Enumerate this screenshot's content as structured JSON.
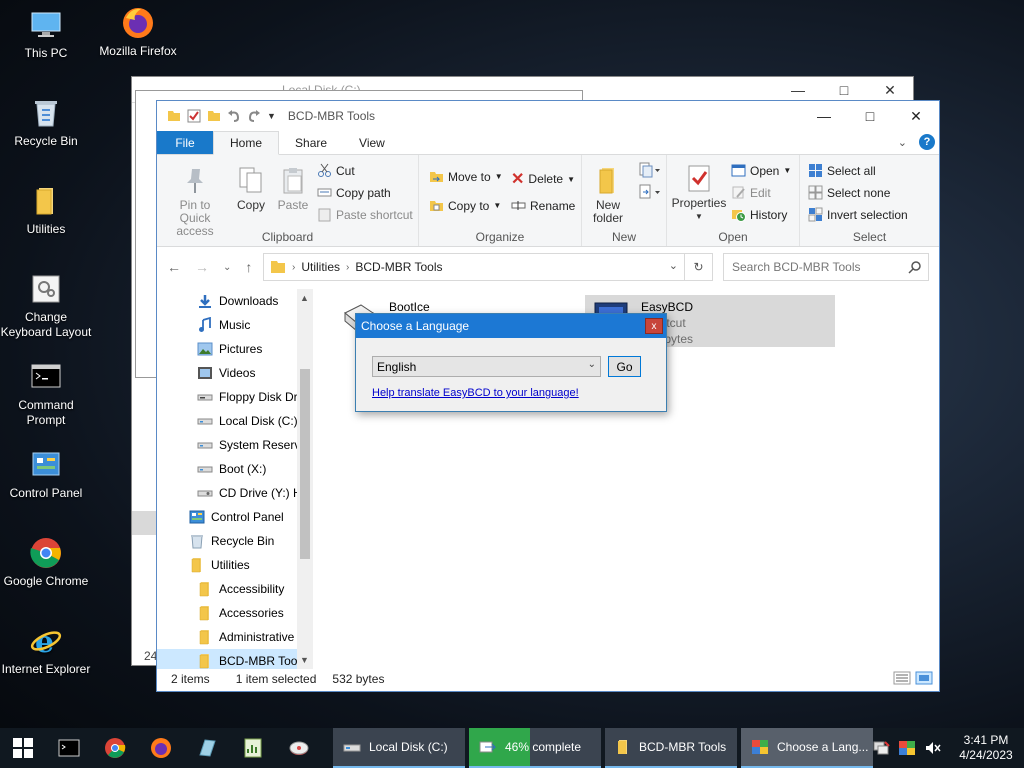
{
  "desktop": {
    "icons": [
      {
        "label": "This PC",
        "icon": "computer-icon"
      },
      {
        "label": "Mozilla Firefox",
        "icon": "firefox-icon"
      },
      {
        "label": "Recycle Bin",
        "icon": "recycle-bin-icon"
      },
      {
        "label": "Utilities",
        "icon": "folder-icon"
      },
      {
        "label": "Change Keyboard Layout",
        "icon": "keyboard-settings-icon"
      },
      {
        "label": "Command Prompt",
        "icon": "command-prompt-icon"
      },
      {
        "label": "Control Panel",
        "icon": "control-panel-icon"
      },
      {
        "label": "Google Chrome",
        "icon": "chrome-icon"
      },
      {
        "label": "Internet Explorer",
        "icon": "internet-explorer-icon"
      }
    ]
  },
  "back_window": {
    "title": "Local Disk (C:)",
    "partial_text": "24"
  },
  "explorer": {
    "title": "BCD-MBR Tools",
    "tabs": {
      "file": "File",
      "home": "Home",
      "share": "Share",
      "view": "View"
    },
    "ribbon": {
      "clipboard": {
        "label": "Clipboard",
        "pin": "Pin to Quick access",
        "copy": "Copy",
        "paste": "Paste",
        "cut": "Cut",
        "copy_path": "Copy path",
        "paste_shortcut": "Paste shortcut"
      },
      "organize": {
        "label": "Organize",
        "move_to": "Move to",
        "copy_to": "Copy to",
        "delete": "Delete",
        "rename": "Rename"
      },
      "new": {
        "label": "New",
        "new_folder": "New folder"
      },
      "open": {
        "label": "Open",
        "properties": "Properties",
        "open": "Open",
        "edit": "Edit",
        "history": "History"
      },
      "select": {
        "label": "Select",
        "select_all": "Select all",
        "select_none": "Select none",
        "invert": "Invert selection"
      }
    },
    "address": {
      "crumbs": [
        "Utilities",
        "BCD-MBR Tools"
      ],
      "search_placeholder": "Search BCD-MBR Tools"
    },
    "nav_items": [
      {
        "label": "Downloads",
        "indent": 1,
        "icon": "downloads-icon"
      },
      {
        "label": "Music",
        "indent": 1,
        "icon": "music-icon"
      },
      {
        "label": "Pictures",
        "indent": 1,
        "icon": "pictures-icon"
      },
      {
        "label": "Videos",
        "indent": 1,
        "icon": "videos-icon"
      },
      {
        "label": "Floppy Disk Drive",
        "indent": 1,
        "icon": "floppy-icon"
      },
      {
        "label": "Local Disk (C:)",
        "indent": 1,
        "icon": "drive-icon"
      },
      {
        "label": "System Reserved",
        "indent": 1,
        "icon": "drive-icon"
      },
      {
        "label": "Boot (X:)",
        "indent": 1,
        "icon": "drive-icon"
      },
      {
        "label": "CD Drive (Y:) H",
        "indent": 1,
        "icon": "cd-drive-icon"
      },
      {
        "label": "Control Panel",
        "indent": 0,
        "icon": "control-panel-icon"
      },
      {
        "label": "Recycle Bin",
        "indent": 0,
        "icon": "recycle-bin-icon"
      },
      {
        "label": "Utilities",
        "indent": 0,
        "icon": "folder-icon"
      },
      {
        "label": "Accessibility",
        "indent": 1,
        "icon": "folder-icon"
      },
      {
        "label": "Accessories",
        "indent": 1,
        "icon": "folder-icon"
      },
      {
        "label": "Administrative",
        "indent": 1,
        "icon": "folder-icon"
      },
      {
        "label": "BCD-MBR Tools",
        "indent": 1,
        "icon": "folder-icon",
        "selected": true
      }
    ],
    "files": [
      {
        "name": "BootIce",
        "sub1": "",
        "sub2": ""
      },
      {
        "name": "EasyBCD",
        "sub1": "Shortcut",
        "sub2": "532 bytes"
      }
    ],
    "status": {
      "items": "2 items",
      "selected": "1 item selected",
      "size": "532 bytes"
    }
  },
  "dialog": {
    "title": "Choose a Language",
    "close": "x",
    "language": "English",
    "go": "Go",
    "link": "Help translate EasyBCD to your language!"
  },
  "taskbar": {
    "tasks": [
      {
        "label": "Local Disk (C:)",
        "icon": "drive-icon"
      },
      {
        "label": "46% complete",
        "icon": "copy-progress-icon",
        "progress": 0.46
      },
      {
        "label": "BCD-MBR Tools",
        "icon": "folder-icon"
      },
      {
        "label": "Choose a Lang...",
        "icon": "easybcd-icon"
      }
    ],
    "time": "3:41 PM",
    "date": "4/24/2023"
  },
  "colors": {
    "accent": "#1979ca",
    "progress": "#30a74b",
    "dialog_title": "#1c78d4"
  }
}
